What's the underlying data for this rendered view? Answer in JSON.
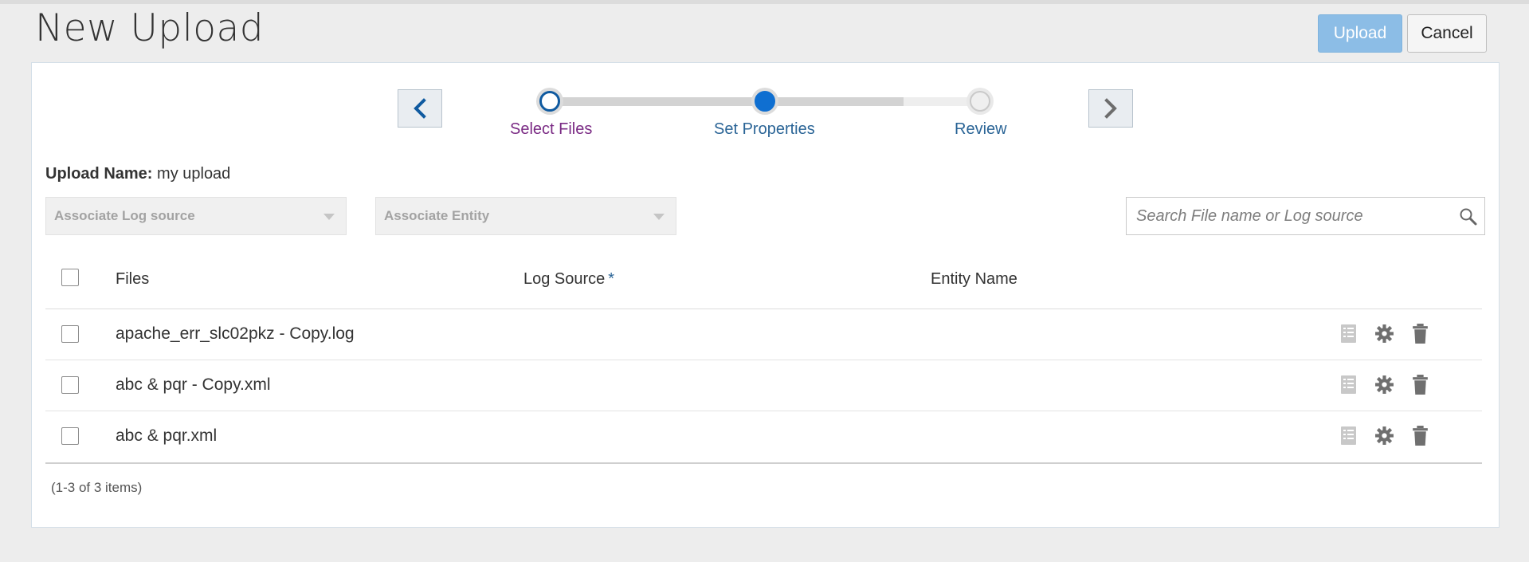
{
  "page": {
    "title": "New Upload"
  },
  "actions": {
    "upload_label": "Upload",
    "cancel_label": "Cancel"
  },
  "wizard": {
    "steps": [
      {
        "label": "Select Files",
        "state": "visited"
      },
      {
        "label": "Set Properties",
        "state": "current"
      },
      {
        "label": "Review",
        "state": "pending"
      }
    ]
  },
  "upload_name": {
    "label": "Upload Name:",
    "value": "my upload"
  },
  "filters": {
    "log_source_placeholder": "Associate Log source",
    "entity_placeholder": "Associate Entity"
  },
  "search": {
    "placeholder": "Search File name or Log source"
  },
  "table": {
    "headers": {
      "files": "Files",
      "log_source": "Log Source",
      "required_mark": "*",
      "entity": "Entity Name"
    },
    "rows": [
      {
        "file": "apache_err_slc02pkz - Copy.log",
        "log_source": "",
        "entity": ""
      },
      {
        "file": "abc & pqr - Copy.xml",
        "log_source": "",
        "entity": ""
      },
      {
        "file": "abc & pqr.xml",
        "log_source": "",
        "entity": ""
      }
    ]
  },
  "pagination": {
    "summary": "(1-3 of 3 items)"
  },
  "colors": {
    "accent": "#0f6fd1",
    "upload_button": "#8cbde6",
    "visited_step": "#7a2a84",
    "link_step": "#2a6496"
  },
  "icons": [
    "chevron-left-icon",
    "chevron-right-icon",
    "search-icon",
    "details-icon",
    "gear-icon",
    "trash-icon"
  ]
}
